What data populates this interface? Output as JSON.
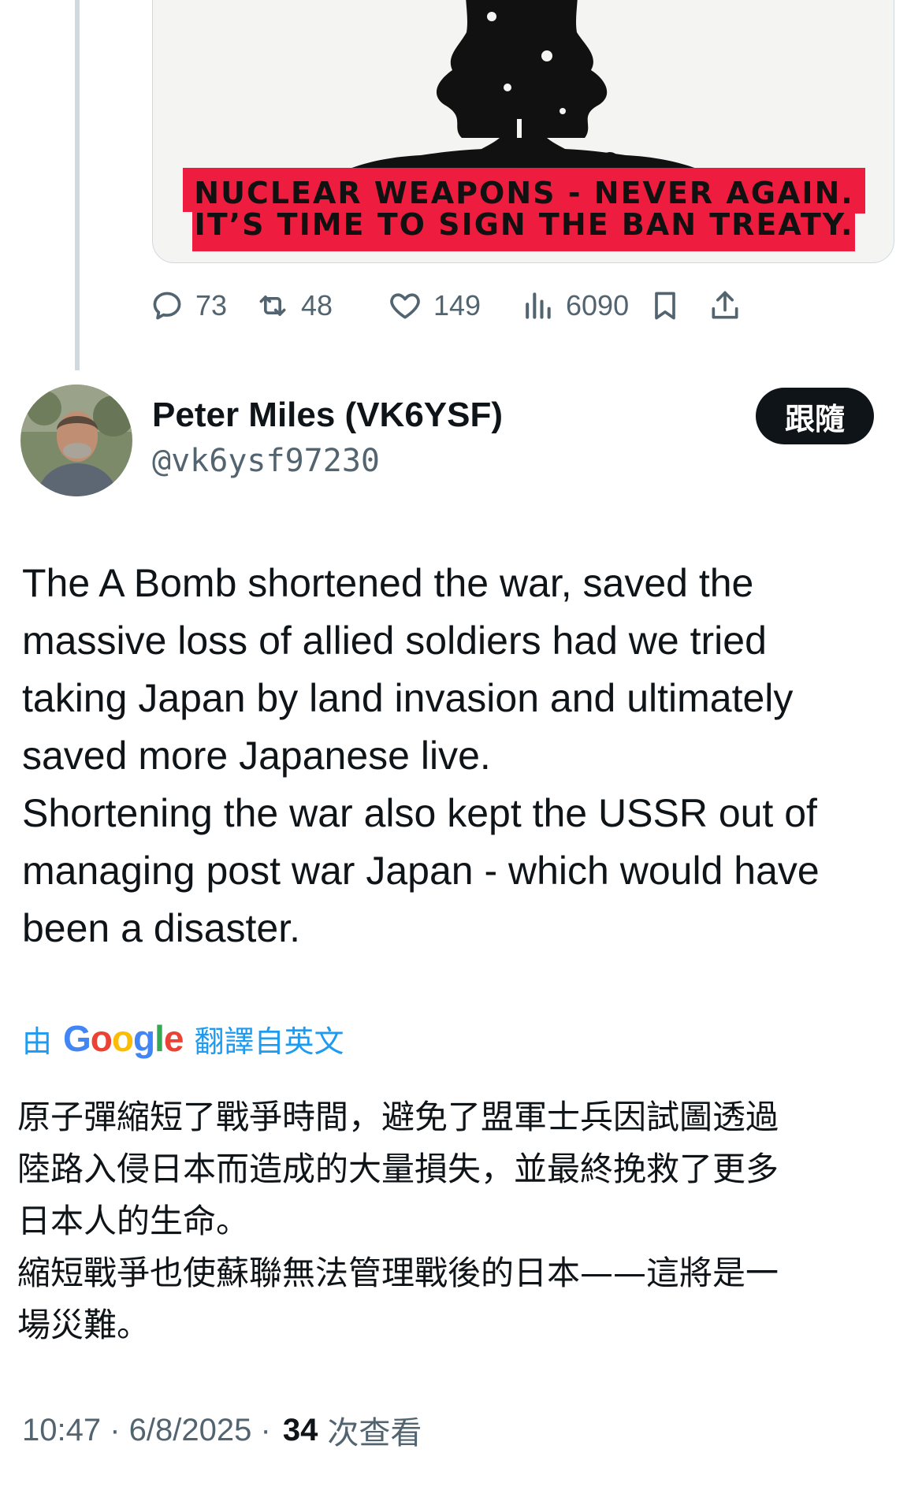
{
  "media": {
    "banner_line1": "NUCLEAR WEAPONS - NEVER AGAIN.",
    "banner_line2": "IT’S TIME TO SIGN THE BAN TREATY.",
    "banner_color": "#ee1c3f"
  },
  "prev_post_actions": {
    "replies": "73",
    "reposts": "48",
    "likes": "149",
    "views": "6090"
  },
  "author": {
    "display_name": "Peter Miles (VK6YSF)",
    "handle": "@vk6ysf97230",
    "follow_label": "跟隨"
  },
  "post": {
    "text": "The A Bomb shortened the war, saved the\nmassive loss of allied soldiers had we tried\ntaking Japan by land invasion and ultimately\nsaved more Japanese live.\nShortening the war also kept the USSR out of\nmanaging post war Japan - which would have\nbeen a disaster."
  },
  "translation": {
    "by_label": "由",
    "provider": "Google",
    "from_label": "翻譯自英文",
    "text": "原子彈縮短了戰爭時間，避免了盟軍士兵因試圖透過\n陸路入侵日本而造成的大量損失，並最終挽救了更多\n日本人的生命。\n縮短戰爭也使蘇聯無法管理戰後的日本——這將是一\n場災難。"
  },
  "meta": {
    "time": "10:47",
    "sep1": " · ",
    "date": "6/8/2025",
    "sep2": " · ",
    "views_count": "34",
    "views_label": "次查看"
  },
  "colors": {
    "accent": "#1d9bf0",
    "text_primary": "#0f1419",
    "text_secondary": "#536471"
  }
}
